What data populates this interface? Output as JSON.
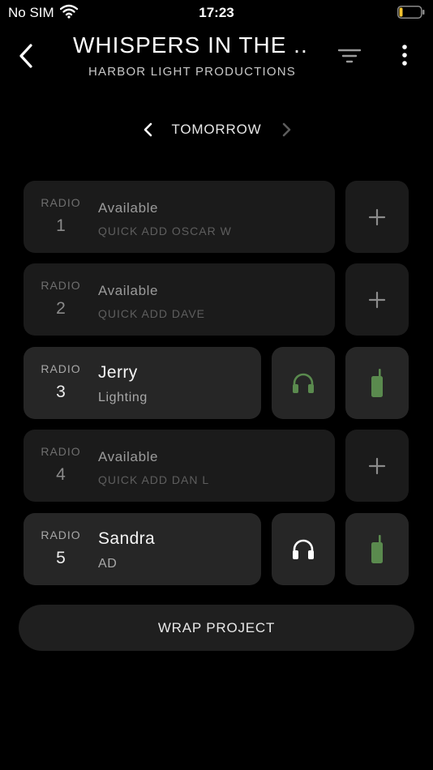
{
  "status_bar": {
    "carrier": "No SIM",
    "time": "17:23",
    "battery_color": "#f4c430"
  },
  "header": {
    "title": "WHISPERS IN THE ...",
    "subtitle": "HARBOR LIGHT PRODUCTIONS"
  },
  "date_nav": {
    "label": "TOMORROW"
  },
  "radios": [
    {
      "label": "RADIO",
      "number": "1",
      "status": "Available",
      "quick_add": "QUICK ADD OSCAR W"
    },
    {
      "label": "RADIO",
      "number": "2",
      "status": "Available",
      "quick_add": "QUICK ADD DAVE"
    },
    {
      "label": "RADIO",
      "number": "3",
      "name": "Jerry",
      "role": "Lighting",
      "headset_color": "#5a8a4e",
      "walkie_color": "#5a8a4e"
    },
    {
      "label": "RADIO",
      "number": "4",
      "status": "Available",
      "quick_add": "QUICK ADD DAN L"
    },
    {
      "label": "RADIO",
      "number": "5",
      "name": "Sandra",
      "role": "AD",
      "headset_color": "#ffffff",
      "walkie_color": "#5a8a4e"
    }
  ],
  "footer": {
    "wrap_label": "WRAP PROJECT"
  },
  "icons": {
    "back": "chevron-left-icon",
    "filter": "filter-icon",
    "more": "more-vertical-icon",
    "add": "plus-icon",
    "headset": "headphones-icon",
    "walkie": "walkie-talkie-icon"
  }
}
